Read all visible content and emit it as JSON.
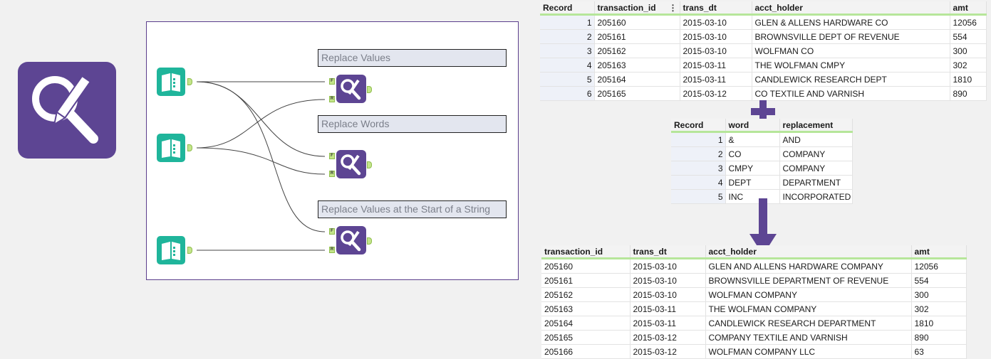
{
  "colors": {
    "purple": "#5d4593",
    "teal": "#1fb59b",
    "anchor_green": "#c4e58a"
  },
  "icons": {
    "big_tool": "find-replace-icon",
    "input": "input-data-book-icon",
    "tool": "find-replace-icon"
  },
  "workflow": {
    "comments": [
      "Replace Values",
      "Replace Words",
      "Replace Values at the Start of a String"
    ],
    "anchor_f": "F",
    "anchor_r": "R"
  },
  "grid_top": {
    "headers": [
      "Record",
      "transaction_id",
      "trans_dt",
      "acct_holder",
      "amt"
    ],
    "rows": [
      [
        "1",
        "205160",
        "2015-03-10",
        "GLEN & ALLENS HARDWARE CO",
        "12056"
      ],
      [
        "2",
        "205161",
        "2015-03-10",
        "BROWNSVILLE DEPT OF REVENUE",
        "554"
      ],
      [
        "3",
        "205162",
        "2015-03-10",
        "WOLFMAN CO",
        "300"
      ],
      [
        "4",
        "205163",
        "2015-03-11",
        "THE WOLFMAN CMPY",
        "302"
      ],
      [
        "5",
        "205164",
        "2015-03-11",
        "CANDLEWICK RESEARCH DEPT",
        "1810"
      ],
      [
        "6",
        "205165",
        "2015-03-12",
        "CO TEXTILE AND VARNISH",
        "890"
      ]
    ]
  },
  "grid_mid": {
    "headers": [
      "Record",
      "word",
      "replacement"
    ],
    "rows": [
      [
        "1",
        "&",
        "AND"
      ],
      [
        "2",
        "CO",
        "COMPANY"
      ],
      [
        "3",
        "CMPY",
        "COMPANY"
      ],
      [
        "4",
        "DEPT",
        "DEPARTMENT"
      ],
      [
        "5",
        "INC",
        "INCORPORATED"
      ]
    ]
  },
  "grid_bottom": {
    "headers": [
      "transaction_id",
      "trans_dt",
      "acct_holder",
      "amt"
    ],
    "rows": [
      [
        "205160",
        "2015-03-10",
        "GLEN AND ALLENS HARDWARE COMPANY",
        "12056"
      ],
      [
        "205161",
        "2015-03-10",
        "BROWNSVILLE DEPARTMENT OF REVENUE",
        "554"
      ],
      [
        "205162",
        "2015-03-10",
        "WOLFMAN COMPANY",
        "300"
      ],
      [
        "205163",
        "2015-03-11",
        "THE WOLFMAN COMPANY",
        "302"
      ],
      [
        "205164",
        "2015-03-11",
        "CANDLEWICK RESEARCH DEPARTMENT",
        "1810"
      ],
      [
        "205165",
        "2015-03-12",
        "COMPANY TEXTILE AND VARNISH",
        "890"
      ],
      [
        "205166",
        "2015-03-12",
        "WOLFMAN COMPANY LLC",
        "63"
      ]
    ]
  }
}
